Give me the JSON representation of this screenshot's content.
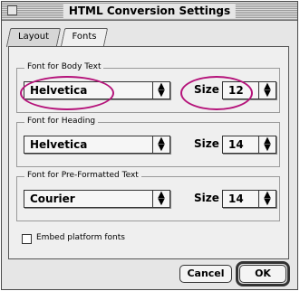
{
  "window": {
    "title": "HTML Conversion Settings"
  },
  "tabs": [
    {
      "label": "Layout",
      "active": false
    },
    {
      "label": "Fonts",
      "active": true
    }
  ],
  "groups": [
    {
      "legend": "Font for Body Text",
      "font": "Helvetica",
      "size_label": "Size",
      "size": "12",
      "highlighted": true
    },
    {
      "legend": "Font for Heading",
      "font": "Helvetica",
      "size_label": "Size",
      "size": "14",
      "highlighted": false
    },
    {
      "legend": "Font for Pre-Formatted Text",
      "font": "Courier",
      "size_label": "Size",
      "size": "14",
      "highlighted": false
    }
  ],
  "embed_fonts": {
    "label": "Embed platform fonts",
    "checked": false
  },
  "buttons": {
    "cancel": "Cancel",
    "ok": "OK"
  },
  "colors": {
    "highlight": "#b5137a",
    "window_bg": "#e6e6e6",
    "panel_bg": "#efefef"
  },
  "icons": {
    "popup_arrow": "up-down-arrows-icon"
  }
}
